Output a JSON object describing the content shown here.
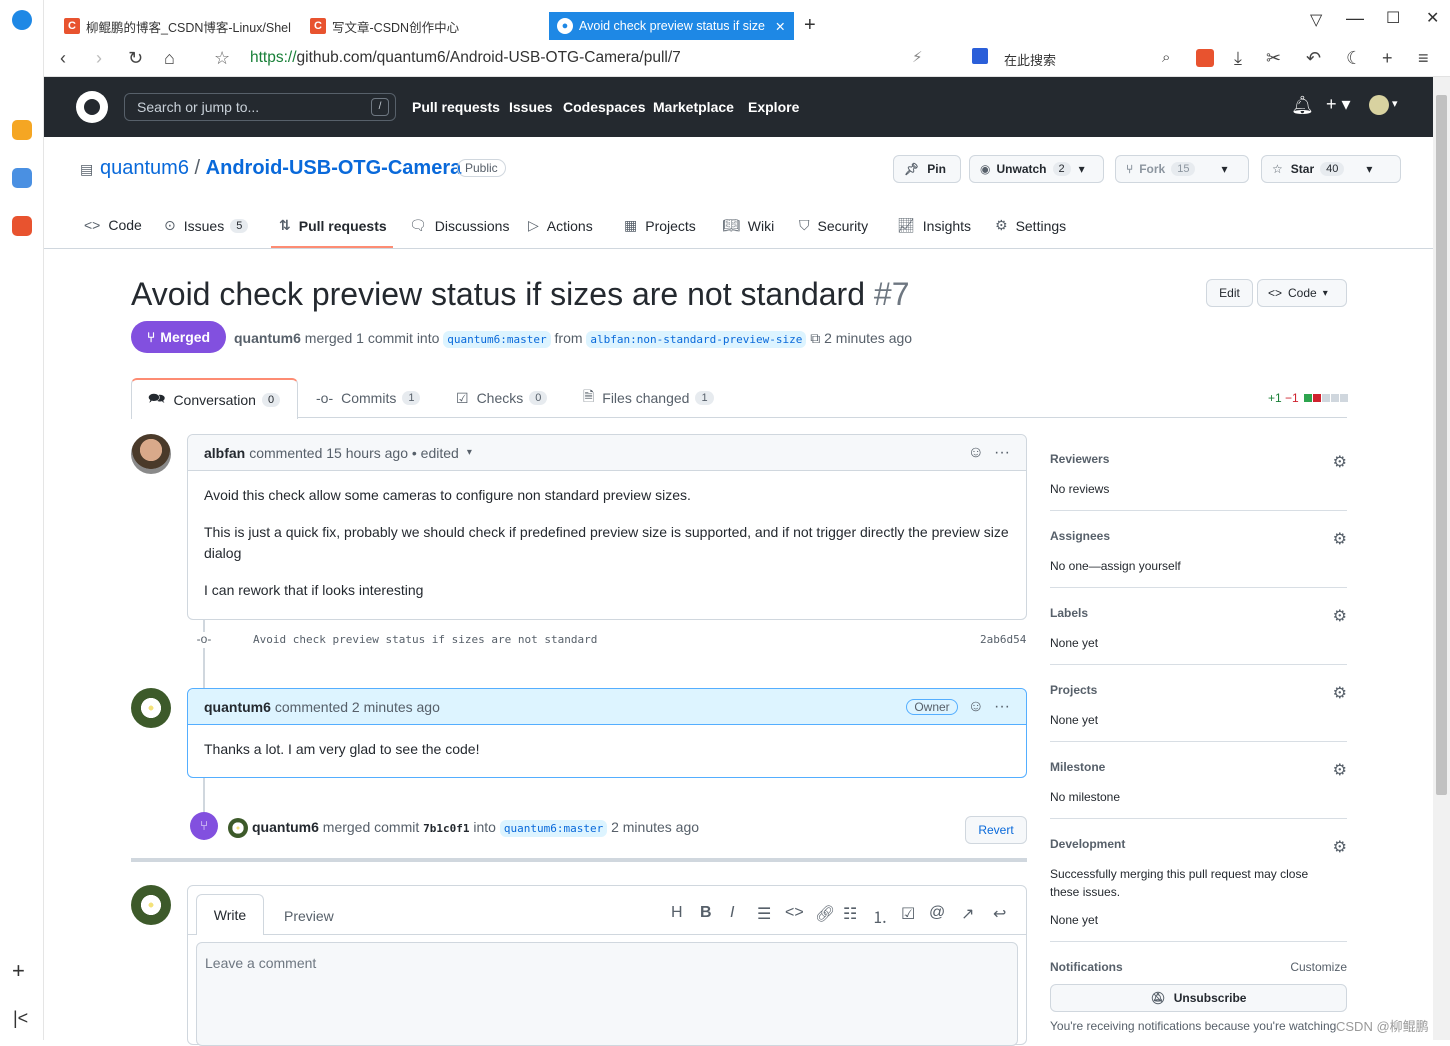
{
  "browser": {
    "tabs": [
      {
        "label": "柳鲲鹏的博客_CSDN博客-Linux/Shel",
        "favicon": "C"
      },
      {
        "label": "写文章-CSDN创作中心",
        "favicon": "C"
      },
      {
        "label": "Avoid check preview status if size",
        "favicon": "gh"
      }
    ],
    "url_scheme": "https://",
    "url_rest": "github.com/quantum6/Android-USB-OTG-Camera/pull/7",
    "search_placeholder": "在此搜索"
  },
  "gh": {
    "search_placeholder": "Search or jump to...",
    "search_key": "/",
    "nav": [
      "Pull requests",
      "Issues",
      "Codespaces",
      "Marketplace",
      "Explore"
    ]
  },
  "repo": {
    "owner": "quantum6",
    "sep": "/",
    "name": "Android-USB-OTG-Camera",
    "visibility": "Public",
    "pin": "Pin",
    "unwatch": "Unwatch",
    "watch_count": "2",
    "fork": "Fork",
    "fork_count": "15",
    "star": "Star",
    "star_count": "40",
    "tabs": [
      {
        "label": "Code"
      },
      {
        "label": "Issues",
        "count": "5"
      },
      {
        "label": "Pull requests"
      },
      {
        "label": "Discussions"
      },
      {
        "label": "Actions"
      },
      {
        "label": "Projects"
      },
      {
        "label": "Wiki"
      },
      {
        "label": "Security"
      },
      {
        "label": "Insights"
      },
      {
        "label": "Settings"
      }
    ]
  },
  "pr": {
    "title": "Avoid check preview status if sizes are not standard",
    "number": "#7",
    "edit": "Edit",
    "code": "Code",
    "state": "Merged",
    "author": "quantum6",
    "merged_text": "merged 1 commit into",
    "base": "quantum6:master",
    "from": "from",
    "head": "albfan:non-standard-preview-size",
    "time": "2 minutes ago",
    "tabs": [
      {
        "label": "Conversation",
        "count": "0"
      },
      {
        "label": "Commits",
        "count": "1"
      },
      {
        "label": "Checks",
        "count": "0"
      },
      {
        "label": "Files changed",
        "count": "1"
      }
    ],
    "diff_add": "+1",
    "diff_del": "−1"
  },
  "comments": [
    {
      "author": "albfan",
      "meta": "commented 15 hours ago • edited",
      "paragraphs": [
        "Avoid this check allow some cameras to configure non standard preview sizes.",
        "This is just a quick fix, probably we should check if predefined preview size is supported, and if not trigger directly the preview size dialog",
        "I can rework that if looks interesting"
      ]
    },
    {
      "author": "quantum6",
      "meta": "commented 2 minutes ago",
      "badge": "Owner",
      "paragraphs": [
        "Thanks a lot. I am very glad to see the code!"
      ]
    }
  ],
  "commit": {
    "message": "Avoid check preview status if sizes are not standard",
    "sha": "2ab6d54"
  },
  "merge_event": {
    "author": "quantum6",
    "text1": "merged commit",
    "sha": "7b1c0f1",
    "text2": "into",
    "base": "quantum6:master",
    "time": "2 minutes ago",
    "revert": "Revert"
  },
  "editor": {
    "write": "Write",
    "preview": "Preview",
    "placeholder": "Leave a comment"
  },
  "sidebar": {
    "reviewers": {
      "title": "Reviewers",
      "value": "No reviews"
    },
    "assignees": {
      "title": "Assignees",
      "value": "No one—assign yourself"
    },
    "labels": {
      "title": "Labels",
      "value": "None yet"
    },
    "projects": {
      "title": "Projects",
      "value": "None yet"
    },
    "milestone": {
      "title": "Milestone",
      "value": "No milestone"
    },
    "development": {
      "title": "Development",
      "value": "Successfully merging this pull request may close these issues.",
      "value2": "None yet"
    },
    "notifications": {
      "title": "Notifications",
      "customize": "Customize",
      "button": "Unsubscribe",
      "note": "You're receiving notifications because you're watching"
    }
  },
  "watermark": "CSDN @柳鲲鹏",
  "colors": {
    "merged": "#8250df",
    "link": "#0969da",
    "header": "#24292f",
    "add": "#1a7f37",
    "del": "#cf222e"
  }
}
